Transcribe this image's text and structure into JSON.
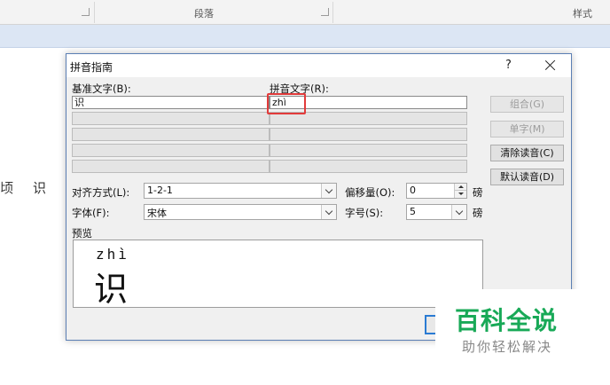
{
  "ribbon": {
    "group_paragraph": "段落",
    "group_styles": "样式"
  },
  "document": {
    "char_left": "顷",
    "char_right": "识"
  },
  "dialog": {
    "title": "拼音指南",
    "help": "?",
    "base_text_label": "基准文字(B):",
    "ruby_text_label": "拼音文字(R):",
    "rows": [
      {
        "base": "识",
        "ruby": "zhì"
      },
      {
        "base": "",
        "ruby": ""
      },
      {
        "base": "",
        "ruby": ""
      },
      {
        "base": "",
        "ruby": ""
      },
      {
        "base": "",
        "ruby": ""
      }
    ],
    "buttons": {
      "group": "组合(G)",
      "mono": "单字(M)",
      "clear": "清除读音(C)",
      "default": "默认读音(D)"
    },
    "alignment_label": "对齐方式(L):",
    "alignment_value": "1-2-1",
    "offset_label": "偏移量(O):",
    "offset_value": "0",
    "offset_unit": "磅",
    "font_label": "字体(F):",
    "font_value": "宋体",
    "size_label": "字号(S):",
    "size_value": "5",
    "size_unit": "磅",
    "preview_label": "预览",
    "preview_pinyin": "zhì",
    "preview_char": "识"
  },
  "watermark": {
    "title": "百科全说",
    "subtitle": "助你轻松解决"
  },
  "colors": {
    "highlight": "#e23b3b",
    "watermark_green": "#18a957",
    "ribbon_blue": "#dce6f4"
  }
}
